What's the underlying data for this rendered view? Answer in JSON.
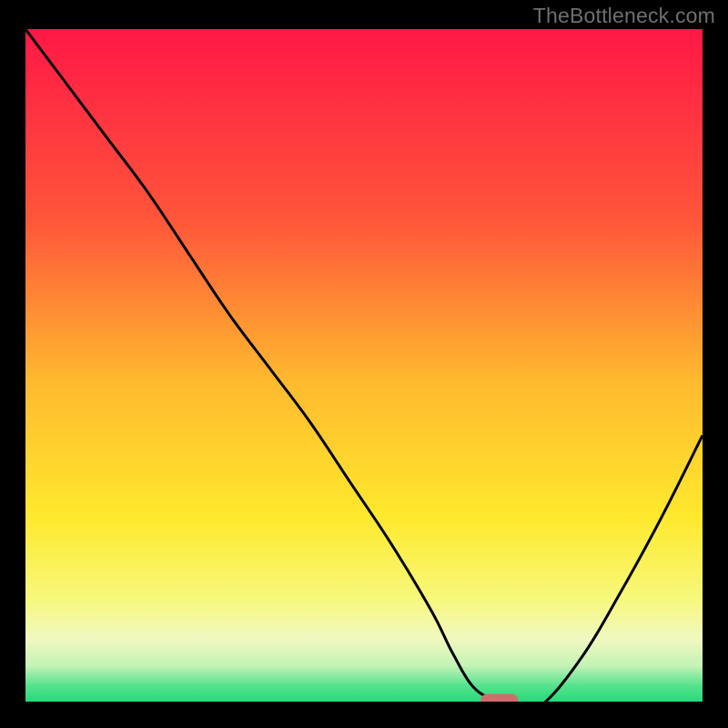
{
  "watermark": "TheBottleneck.com",
  "chart_data": {
    "type": "line",
    "title": "",
    "xlabel": "",
    "ylabel": "",
    "xlim": [
      0,
      100
    ],
    "ylim": [
      0,
      100
    ],
    "grid": false,
    "gradient_stops": [
      {
        "offset": 0,
        "color": "#ff1846"
      },
      {
        "offset": 28,
        "color": "#ff553a"
      },
      {
        "offset": 52,
        "color": "#ffb92e"
      },
      {
        "offset": 72,
        "color": "#ffe92d"
      },
      {
        "offset": 84,
        "color": "#f7f87a"
      },
      {
        "offset": 90,
        "color": "#f1f8bf"
      },
      {
        "offset": 94,
        "color": "#c5f3b6"
      },
      {
        "offset": 97,
        "color": "#55e28d"
      },
      {
        "offset": 100,
        "color": "#19d874"
      }
    ],
    "series": [
      {
        "name": "bottleneck-curve",
        "x": [
          0,
          6,
          12,
          18,
          24,
          30,
          36,
          42,
          48,
          54,
          60,
          63,
          66,
          69,
          72,
          76,
          82,
          88,
          94,
          100
        ],
        "y": [
          100,
          92,
          84,
          76,
          67,
          58,
          50,
          42,
          33,
          24,
          14,
          8,
          3,
          1,
          0,
          0,
          7,
          17,
          28,
          40
        ]
      }
    ],
    "marker": {
      "name": "optimal-marker",
      "x": 70,
      "y": 0.5,
      "color": "#cf6d6d",
      "width": 5.5,
      "height": 2.6
    }
  }
}
